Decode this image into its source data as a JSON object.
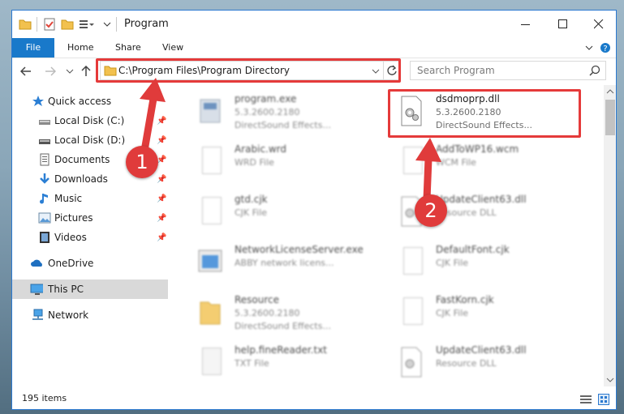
{
  "window": {
    "title": "Program"
  },
  "ribbon": {
    "tabs": [
      {
        "label": "File"
      },
      {
        "label": "Home"
      },
      {
        "label": "Share"
      },
      {
        "label": "View"
      }
    ]
  },
  "address": {
    "path": "C:\\Program Files\\Program Directory"
  },
  "search": {
    "placeholder": "Search Program"
  },
  "nav": {
    "items": [
      {
        "label": "Quick access",
        "icon": "star-icon"
      },
      {
        "label": "Local Disk (C:)",
        "icon": "drive-icon",
        "pinned": true
      },
      {
        "label": "Local Disk (D:)",
        "icon": "drive-icon",
        "pinned": true
      },
      {
        "label": "Documents",
        "icon": "documents-icon",
        "pinned": true
      },
      {
        "label": "Downloads",
        "icon": "download-icon",
        "pinned": true
      },
      {
        "label": "Music",
        "icon": "music-icon",
        "pinned": true
      },
      {
        "label": "Pictures",
        "icon": "pictures-icon",
        "pinned": true
      },
      {
        "label": "Videos",
        "icon": "videos-icon",
        "pinned": true
      },
      {
        "label": "OneDrive",
        "icon": "cloud-icon"
      },
      {
        "label": "This PC",
        "icon": "computer-icon",
        "selected": true
      },
      {
        "label": "Network",
        "icon": "network-icon"
      }
    ]
  },
  "files": {
    "left": [
      {
        "name": "program.exe",
        "version": "5.3.2600.2180",
        "desc": "DirectSound Effects..."
      },
      {
        "name": "Arabic.wrd",
        "version": "WRD File",
        "desc": ""
      },
      {
        "name": "gtd.cjk",
        "version": "CJK File",
        "desc": ""
      },
      {
        "name": "NetworkLicenseServer.exe",
        "version": "ABBY network licens...",
        "desc": ""
      },
      {
        "name": "Resource",
        "version": "5.3.2600.2180",
        "desc": "DirectSound Effects..."
      },
      {
        "name": "help.fineReader.txt",
        "version": "TXT File",
        "desc": ""
      }
    ],
    "right": [
      {
        "name": "dsdmoprp.dll",
        "version": "5.3.2600.2180",
        "desc": "DirectSound Effects..."
      },
      {
        "name": "AddToWP16.wcm",
        "version": "WCM File",
        "desc": ""
      },
      {
        "name": "UpdateClient63.dll",
        "version": "Resource DLL",
        "desc": ""
      },
      {
        "name": "DefaultFont.cjk",
        "version": "CJK File",
        "desc": ""
      },
      {
        "name": "FastKorn.cjk",
        "version": "CJK File",
        "desc": ""
      },
      {
        "name": "UpdateClient63.dll",
        "version": "Resource DLL",
        "desc": ""
      }
    ]
  },
  "status": {
    "count": "195 items"
  },
  "annotations": {
    "badge1": "1",
    "badge2": "2",
    "highlight_color": "#e53a3a"
  }
}
